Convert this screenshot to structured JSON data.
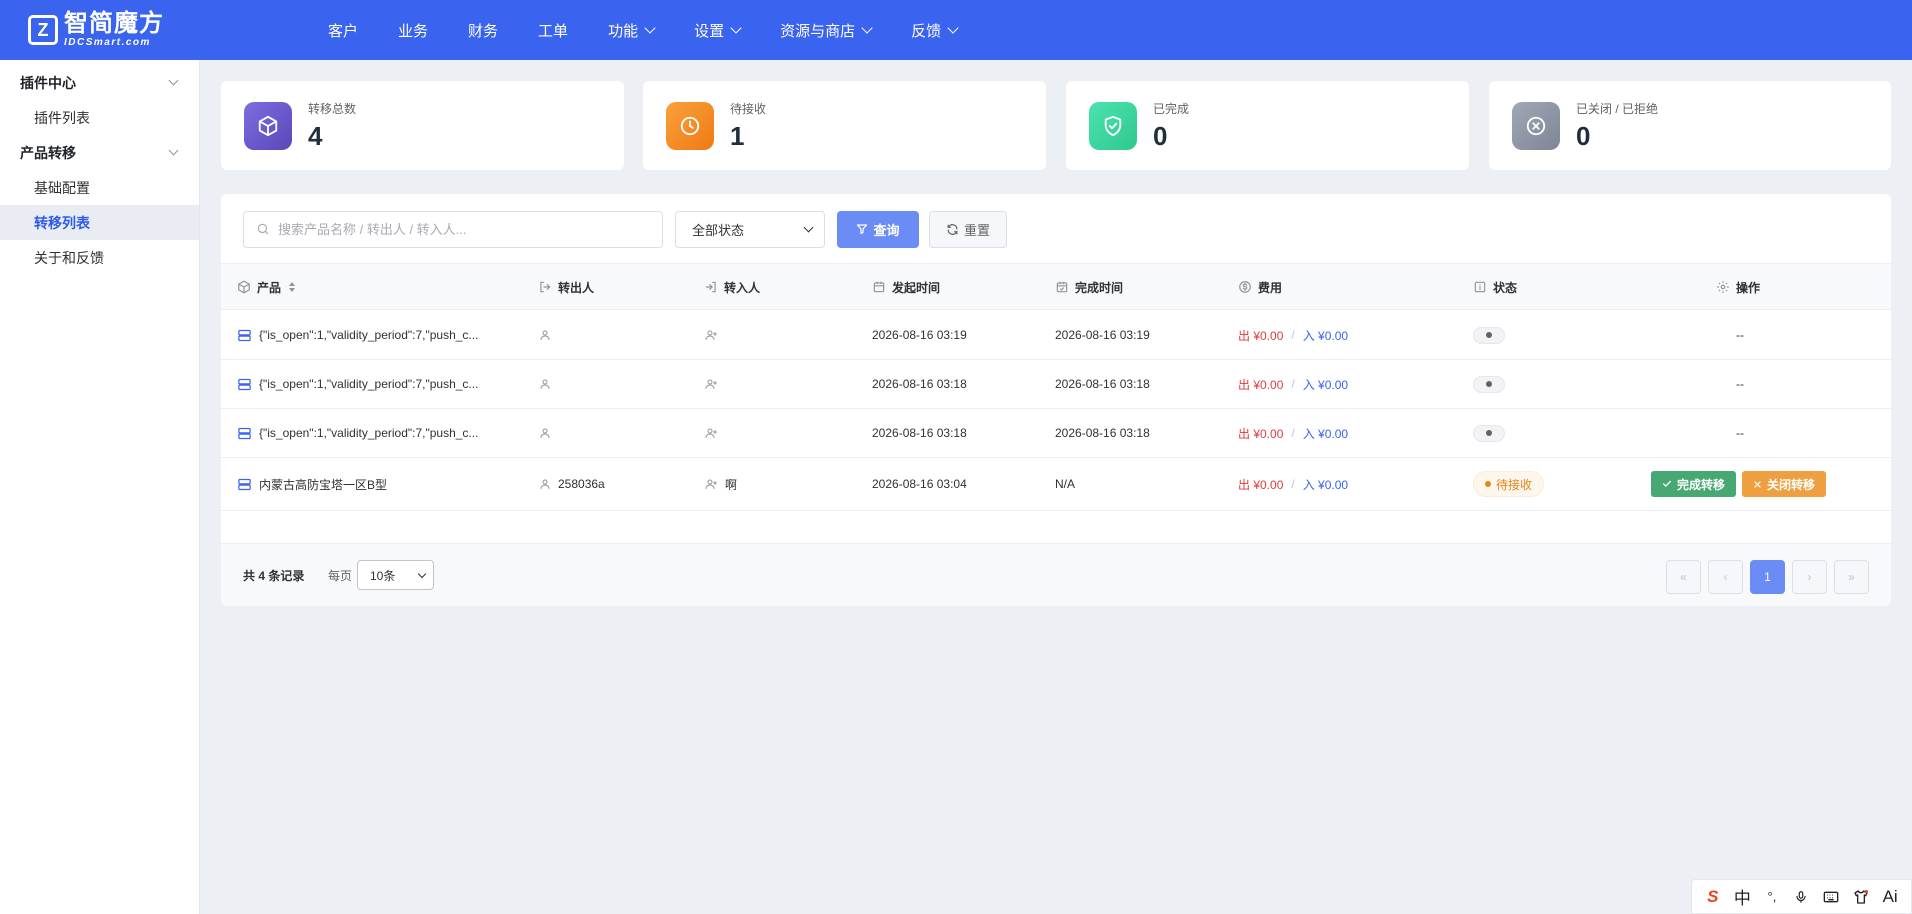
{
  "brand": {
    "logo_mark": "Z",
    "name_cn": "智简魔方",
    "name_en": "IDCSmart.com"
  },
  "nav": {
    "items": [
      {
        "label": "客户",
        "has_dropdown": false
      },
      {
        "label": "业务",
        "has_dropdown": false
      },
      {
        "label": "财务",
        "has_dropdown": false
      },
      {
        "label": "工单",
        "has_dropdown": false
      },
      {
        "label": "功能",
        "has_dropdown": true
      },
      {
        "label": "设置",
        "has_dropdown": true
      },
      {
        "label": "资源与商店",
        "has_dropdown": true
      },
      {
        "label": "反馈",
        "has_dropdown": true
      }
    ]
  },
  "sidebar": {
    "groups": [
      {
        "label": "插件中心",
        "items": [
          {
            "label": "插件列表",
            "active": false
          }
        ]
      },
      {
        "label": "产品转移",
        "items": [
          {
            "label": "基础配置",
            "active": false
          },
          {
            "label": "转移列表",
            "active": true
          },
          {
            "label": "关于和反馈",
            "active": false
          }
        ]
      }
    ]
  },
  "stats": [
    {
      "label": "转移总数",
      "value": "4",
      "icon": "box-icon",
      "color": "#6f57c9"
    },
    {
      "label": "待接收",
      "value": "1",
      "icon": "clock-icon",
      "color": "#f5871f"
    },
    {
      "label": "已完成",
      "value": "0",
      "icon": "shield-check-icon",
      "color": "#3fd6a0"
    },
    {
      "label": "已关闭 / 已拒绝",
      "value": "0",
      "icon": "close-circle-icon",
      "color": "#8e96a6"
    }
  ],
  "toolbar": {
    "search_placeholder": "搜索产品名称 / 转出人 / 转入人...",
    "status_select": "全部状态",
    "query_label": "查询",
    "reset_label": "重置"
  },
  "table": {
    "columns": {
      "product": "产品",
      "from_user": "转出人",
      "to_user": "转入人",
      "start_time": "发起时间",
      "finish_time": "完成时间",
      "fee": "费用",
      "status": "状态",
      "actions": "操作"
    },
    "rows": [
      {
        "product": "{\"is_open\":1,\"validity_period\":7,\"push_c...",
        "from_user": "",
        "to_user": "",
        "start_time": "2026-08-16 03:19",
        "finish_time": "2026-08-16 03:19",
        "fee_out": "出 ¥0.00",
        "fee_sep": "/",
        "fee_in": "入 ¥0.00",
        "status": "",
        "action_text": "--"
      },
      {
        "product": "{\"is_open\":1,\"validity_period\":7,\"push_c...",
        "from_user": "",
        "to_user": "",
        "start_time": "2026-08-16 03:18",
        "finish_time": "2026-08-16 03:18",
        "fee_out": "出 ¥0.00",
        "fee_sep": "/",
        "fee_in": "入 ¥0.00",
        "status": "",
        "action_text": "--"
      },
      {
        "product": "{\"is_open\":1,\"validity_period\":7,\"push_c...",
        "from_user": "",
        "to_user": "",
        "start_time": "2026-08-16 03:18",
        "finish_time": "2026-08-16 03:18",
        "fee_out": "出 ¥0.00",
        "fee_sep": "/",
        "fee_in": "入 ¥0.00",
        "status": "",
        "action_text": "--"
      },
      {
        "product": "内蒙古高防宝塔一区B型",
        "from_user": "258036a",
        "to_user": "啊",
        "start_time": "2026-08-16 03:04",
        "finish_time": "N/A",
        "fee_out": "出 ¥0.00",
        "fee_sep": "/",
        "fee_in": "入 ¥0.00",
        "status": "待接收",
        "complete_label": "完成转移",
        "close_label": "关闭转移"
      }
    ]
  },
  "footer": {
    "total": "共 4 条记录",
    "perpage_label": "每页",
    "perpage_value": "10条",
    "pager": {
      "first": "«",
      "prev": "‹",
      "current": "1",
      "next": "›",
      "last": "»"
    }
  },
  "ime": {
    "logo": "S",
    "lang": "中",
    "punct": "°,",
    "mic": "mic-icon",
    "keyboard": "keyboard-icon",
    "skin": "shirt-icon",
    "ai": "Ai"
  }
}
